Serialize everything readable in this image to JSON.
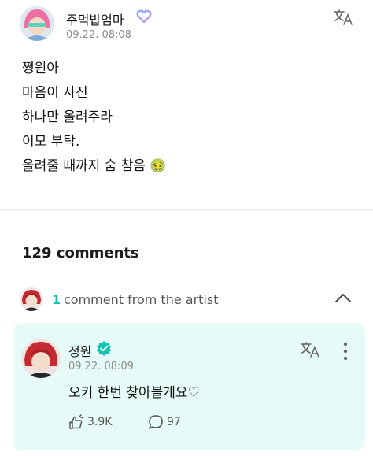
{
  "post": {
    "author": "주먹밥엄마",
    "date": "09.22. 08:08",
    "lines": [
      "쪙원아",
      "마음이 사진",
      "하나만 올려주라",
      "이모 부탁.",
      "올려줄 때까지 숨 참음"
    ],
    "emoji": "🤢"
  },
  "comments": {
    "count_label": "129 comments"
  },
  "artist_section": {
    "count": "1",
    "label": "comment from the artist"
  },
  "artist_comment": {
    "name": "정원",
    "date": "09.22. 08:09",
    "text": "오키 한번 찾아볼게요♡",
    "likes": "3.9K",
    "replies": "97"
  },
  "colors": {
    "accent": "#11c3b0",
    "card_background": "#e6fbf7"
  },
  "icons": [
    "verified-heart-icon",
    "translate-icon",
    "chevron-up-icon",
    "verified-badge-icon",
    "more-icon",
    "like-icon",
    "reply-icon"
  ]
}
